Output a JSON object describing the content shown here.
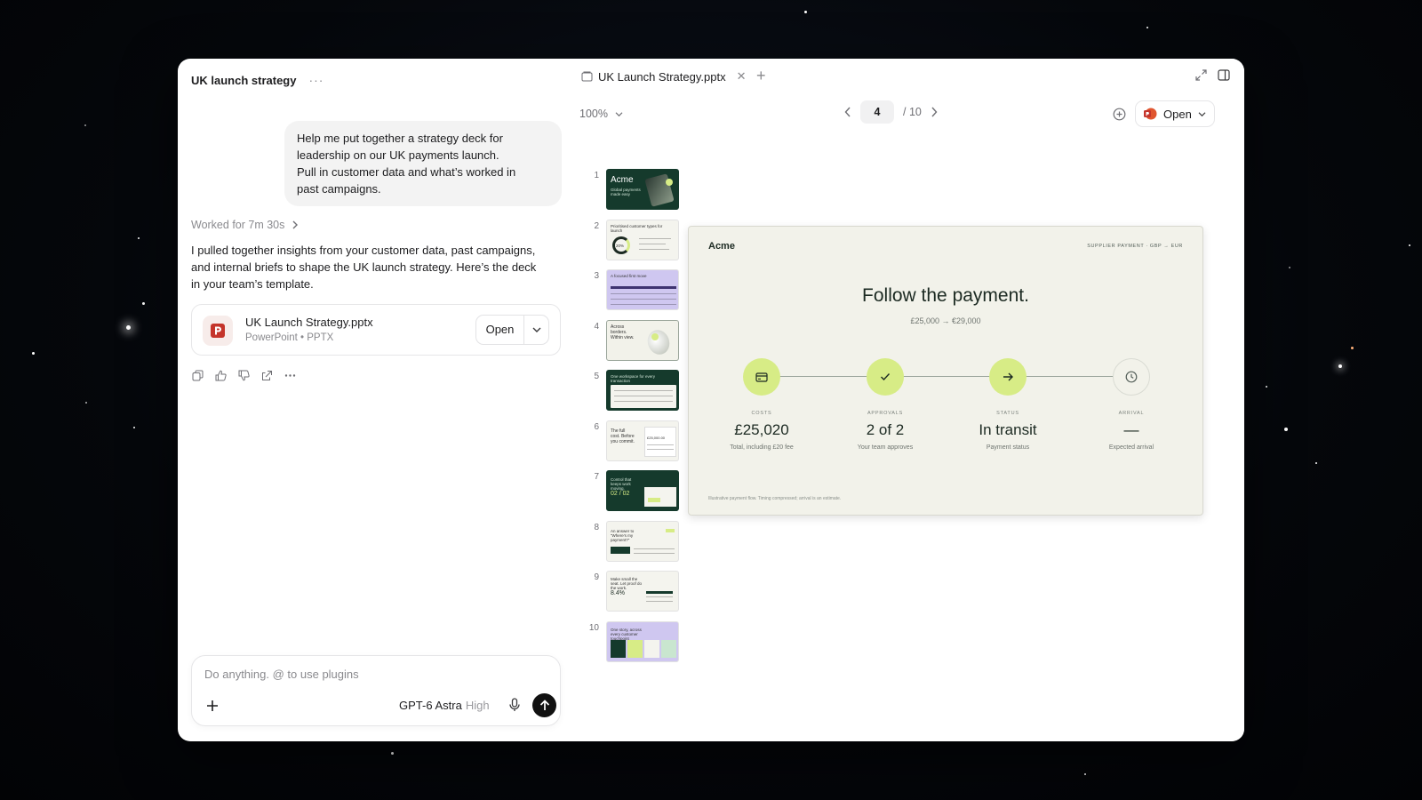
{
  "chat": {
    "title": "UK launch strategy",
    "user_message": "Help me put together a strategy deck for\nleadership on our UK payments launch.\nPull in customer data and what’s worked in\npast campaigns.",
    "worked_label": "Worked for 7m 30s",
    "reply": "I pulled together insights from your customer data, past campaigns, and internal briefs to shape the UK launch strategy. Here’s the deck in your team’s template.",
    "file": {
      "name": "UK Launch Strategy.pptx",
      "meta": "PowerPoint • PPTX",
      "open_label": "Open"
    },
    "composer": {
      "placeholder": "Do anything. @ to use plugins",
      "value": "",
      "model": "GPT-6 Astra",
      "effort": "High"
    }
  },
  "viewer": {
    "tab_label": "UK Launch Strategy.pptx",
    "zoom": "100%",
    "current_page": "4",
    "total_pages": "/ 10",
    "open_label": "Open",
    "thumbnails": [
      {
        "num": "1",
        "title": "Acme",
        "caption": "Global payments made easy"
      },
      {
        "num": "2",
        "title": "Prioritised customer types for launch",
        "caption": "20%"
      },
      {
        "num": "3",
        "title": "A focused first move",
        "caption": ""
      },
      {
        "num": "4",
        "title": "Across borders. Within view.",
        "caption": ""
      },
      {
        "num": "5",
        "title": "One workspace for every transaction",
        "caption": ""
      },
      {
        "num": "6",
        "title": "The full cost. Before you commit.",
        "caption": "£25,000.00"
      },
      {
        "num": "7",
        "title": "Control that keeps work moving.",
        "caption": "02 / 02"
      },
      {
        "num": "8",
        "title": "An answer to “Where’s my payment?”",
        "caption": ""
      },
      {
        "num": "9",
        "title": "Make small the seat. Let proof do the work.",
        "caption": "8.4%"
      },
      {
        "num": "10",
        "title": "One story, across every customer touchpoint",
        "caption": ""
      }
    ]
  },
  "slide": {
    "brand": "Acme",
    "tag": "SUPPLIER PAYMENT · GBP → EUR",
    "title": "Follow the payment.",
    "subtitle": "£25,000 → €29,000",
    "steps": [
      {
        "caption": "COSTS",
        "value": "£25,020",
        "desc": "Total, including £20 fee",
        "icon": "card-icon",
        "state": "active"
      },
      {
        "caption": "APPROVALS",
        "value": "2 of 2",
        "desc": "Your team approves",
        "icon": "check-icon",
        "state": "active"
      },
      {
        "caption": "STATUS",
        "value": "In transit",
        "desc": "Payment status",
        "icon": "arrow-right-icon",
        "state": "active"
      },
      {
        "caption": "ARRIVAL",
        "value": "—",
        "desc": "Expected arrival",
        "icon": "clock-icon",
        "state": "idle"
      }
    ],
    "footnote": "Illustrative payment flow. Timing compressed; arrival is an estimate."
  },
  "colors": {
    "accent_green": "#d7ec86",
    "dark_green": "#153a2c",
    "lavender": "#cfc7f0",
    "slide_bg": "#f2f2ea",
    "ppt_red": "#c4342b"
  }
}
